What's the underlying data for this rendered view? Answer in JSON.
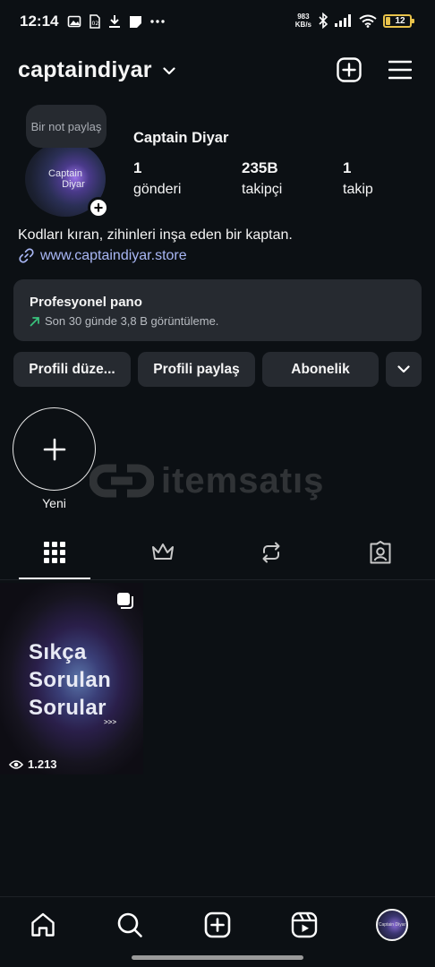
{
  "status_bar": {
    "time": "12:14",
    "net_speed_value": "983",
    "net_speed_unit": "KB/s",
    "battery": "12",
    "icons": [
      "photo-icon",
      "sim-icon",
      "download-icon",
      "notification-icon",
      "more-icon",
      "bluetooth-icon",
      "signal-icon",
      "wifi-icon",
      "battery-icon"
    ]
  },
  "header": {
    "username": "captaindiyar",
    "actions": [
      "create-icon",
      "menu-icon"
    ]
  },
  "profile": {
    "note": "Bir not paylaş",
    "avatar_text_line1": "Captain",
    "avatar_text_line2": "Diyar",
    "display_name": "Captain Diyar",
    "stats": [
      {
        "value": "1",
        "label": "gönderi"
      },
      {
        "value": "235B",
        "label": "takipçi"
      },
      {
        "value": "1",
        "label": "takip"
      }
    ],
    "bio": "Kodları kıran, zihinleri inşa eden bir kaptan.",
    "link": "www.captaindiyar.store"
  },
  "dashboard": {
    "title": "Profesyonel pano",
    "subtitle": "Son 30 günde 3,8 B görüntüleme."
  },
  "buttons": {
    "edit": "Profili düze...",
    "share": "Profili paylaş",
    "subscription": "Abonelik"
  },
  "highlight": {
    "label": "Yeni"
  },
  "watermark": {
    "text": "itemsatış"
  },
  "tabs": [
    "grid-icon",
    "crown-icon",
    "reposts-icon",
    "tagged-icon"
  ],
  "posts": [
    {
      "line1": "Sıkça",
      "line2": "Sorulan",
      "line3": "Sorular",
      "more": ">>>",
      "views": "1.213"
    }
  ],
  "bottom_nav": [
    "home-icon",
    "search-icon",
    "create-icon",
    "reels-icon",
    "profile-avatar"
  ],
  "colors": {
    "background": "#0c1014",
    "surface": "#262a30",
    "link": "#a9b7f5",
    "trend_green": "#3ac47d",
    "battery": "#e8c24a"
  }
}
